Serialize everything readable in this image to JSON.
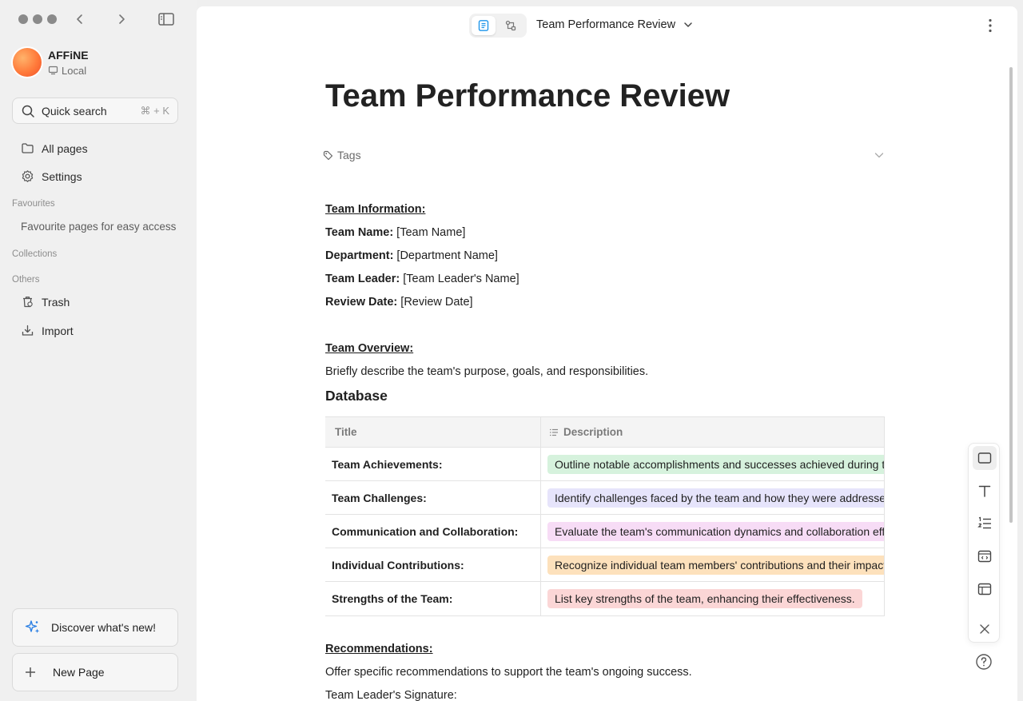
{
  "app": {
    "name": "AFFiNE",
    "storage": "Local"
  },
  "search": {
    "label": "Quick search",
    "shortcut": "⌘ + K"
  },
  "nav": {
    "all_pages": "All pages",
    "settings": "Settings",
    "trash": "Trash",
    "import": "Import"
  },
  "sections": {
    "favourites": "Favourites",
    "favourites_empty": "Favourite pages for easy access",
    "collections": "Collections",
    "others": "Others"
  },
  "buttons": {
    "discover": "Discover what's new!",
    "new_page": "New Page"
  },
  "header": {
    "doc_title": "Team Performance Review"
  },
  "doc": {
    "title": "Team Performance Review",
    "tags_label": "Tags",
    "team_info_heading": "Team Information:",
    "fields": [
      {
        "label": "Team Name:",
        "value": " [Team Name]"
      },
      {
        "label": "Department:",
        "value": " [Department Name]"
      },
      {
        "label": "Team Leader:",
        "value": " [Team Leader's Name]"
      },
      {
        "label": "Review Date:",
        "value": " [Review Date]"
      }
    ],
    "overview_heading": "Team Overview:",
    "overview_text": "Briefly describe the team's purpose, goals, and responsibilities.",
    "database_title": "Database",
    "recommendations_heading": "Recommendations:",
    "recommendations_text": "Offer specific recommendations to support the team's ongoing success.",
    "signature_partial": "Team Leader's Signature:"
  },
  "table": {
    "headers": {
      "title": "Title",
      "description": "Description"
    },
    "rows": [
      {
        "title": "Team Achievements:",
        "description": "Outline notable accomplishments and successes achieved during the review period.",
        "color": "#d6f2dd"
      },
      {
        "title": "Team Challenges:",
        "description": "Identify challenges faced by the team and how they were addressed.",
        "color": "#e6e4fb"
      },
      {
        "title": "Communication and Collaboration:",
        "description": "Evaluate the team's communication dynamics and collaboration efforts.",
        "color": "#f7dcf6"
      },
      {
        "title": "Individual Contributions:",
        "description": "Recognize individual team members' contributions and their impact.",
        "color": "#fde1bc"
      },
      {
        "title": "Strengths of the Team:",
        "description": "List key strengths of the team, enhancing their effectiveness.",
        "color": "#fbd6d6"
      }
    ]
  },
  "icons": {
    "toolbar": [
      "frame-icon",
      "text-icon",
      "numbered-list-icon",
      "embed-icon",
      "layout-icon",
      "close-icon"
    ],
    "help": "help-icon"
  }
}
